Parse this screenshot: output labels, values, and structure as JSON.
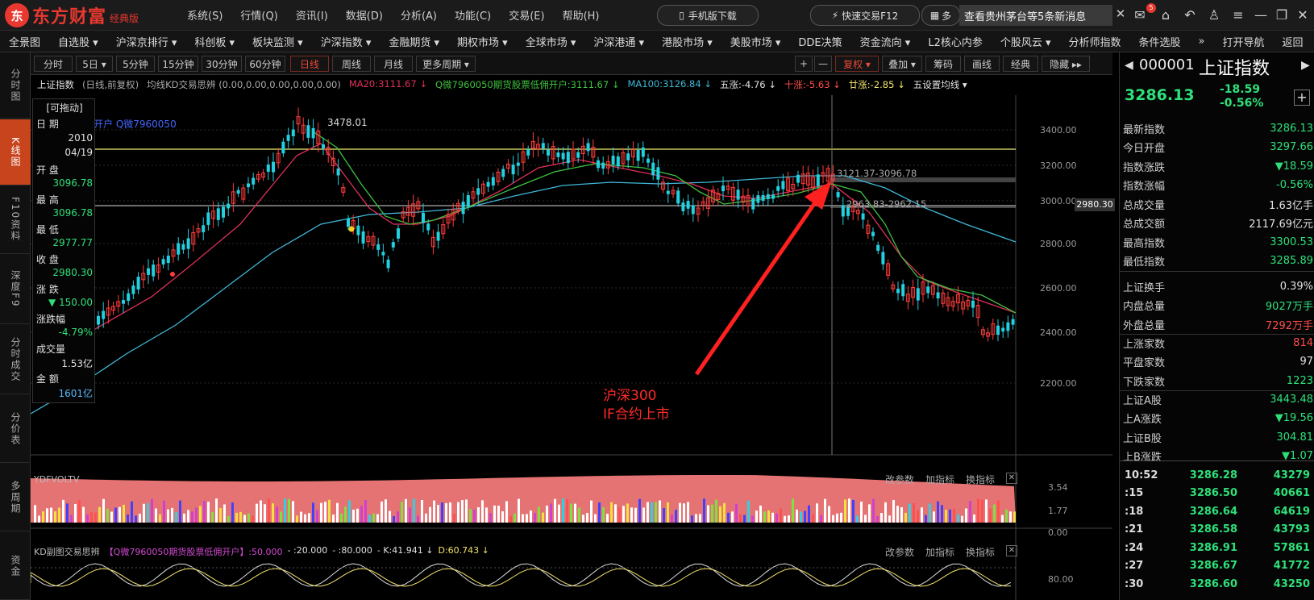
{
  "titlebar": {
    "logo_text": "东方财富",
    "edition": "经典版",
    "menu": [
      "系统(S)",
      "行情(Q)",
      "资讯(I)",
      "数据(D)",
      "分析(A)",
      "功能(C)",
      "交易(E)",
      "帮助(H)"
    ],
    "mobile_button": "手机版下载",
    "quick_trade": "快速交易F12",
    "multi_label": "多",
    "notice": "查看贵州茅台等5条新消息",
    "mail_badge": "5"
  },
  "navbar": [
    "全景图",
    "自选股 ▾",
    "沪深京排行 ▾",
    "科创板 ▾",
    "板块监测 ▾",
    "沪深指数 ▾",
    "金融期货 ▾",
    "期权市场 ▾",
    "全球市场 ▾",
    "沪深港通 ▾",
    "港股市场 ▾",
    "美股市场 ▾",
    "DDE决策",
    "资金流向 ▾",
    "L2核心内参",
    "个股风云 ▾",
    "分析师指数",
    "条件选股",
    "»",
    "打开导航",
    "返回"
  ],
  "left_tabs": [
    {
      "label": "分时图",
      "active": false
    },
    {
      "label": "K线图",
      "active": true
    },
    {
      "label": "F10资料",
      "active": false
    },
    {
      "label": "深度F9",
      "active": false
    },
    {
      "label": "分时成交",
      "active": false
    },
    {
      "label": "分价表",
      "active": false
    },
    {
      "label": "多周期",
      "active": false
    },
    {
      "label": "资金",
      "active": false
    }
  ],
  "period_bar": {
    "items": [
      "分时",
      "5日 ▾",
      "5分钟",
      "15分钟",
      "30分钟",
      "60分钟",
      "日线",
      "周线",
      "月线",
      "更多周期 ▾"
    ],
    "active": "日线",
    "right_items": [
      "+",
      "—",
      "复权 ▾",
      "叠加 ▾",
      "筹码",
      "画线",
      "经典",
      "隐藏 ▸▸"
    ]
  },
  "chart_title": {
    "name": "上证指数",
    "mode": "(日线,前复权)",
    "indicator": "均线KD交易思辨 (0.00,0.00,0.00,0.00,0.00)",
    "ma20": "MA20:3111.67 ↓",
    "promo": "Q微7960050期货股票低佣开户:3111.67 ↓",
    "ma100": "MA100:3126.84 ↓",
    "wuzhang": "五涨:-4.76 ↓",
    "shizhang": "十涨:-5.63 ↓",
    "nianzhang": "廿涨:-2.85 ↓",
    "setting": "五设置均线 ▾"
  },
  "overlay_text": "开户 Q微7960050",
  "infobox": {
    "header": "[可拖动]",
    "date_label": "日 期",
    "date_year": "2010",
    "date_md": "04/19",
    "open_label": "开 盘",
    "open": "3096.78",
    "high_label": "最 高",
    "high": "3096.78",
    "low_label": "最 低",
    "low": "2977.77",
    "close_label": "收 盘",
    "close": "2980.30",
    "chg_label": "涨 跌",
    "chg": "▼ 150.00",
    "pct_label": "涨跌幅",
    "pct": "-4.79%",
    "vol_label": "成交量",
    "vol": "1.53亿",
    "amt_label": "金 额",
    "amt": "1601亿"
  },
  "annotations": {
    "peak": "3478.01",
    "range_top": "3121.37-3096.78",
    "range_bottom": "2963.83-2962.15",
    "event_line1": "沪深300",
    "event_line2": "IF合约上市"
  },
  "price_axis": {
    "ticks": [
      "3400.00",
      "3200.00",
      "3000.00",
      "2800.00",
      "2600.00",
      "2400.00",
      "2200.00"
    ],
    "current": "2980.30"
  },
  "volume_panel": {
    "title": "YDFVOLTV",
    "buttons": [
      "改参数",
      "加指标",
      "换指标"
    ],
    "ticks": [
      "3.54",
      "1.77",
      "0.00"
    ]
  },
  "kd_panel": {
    "title": "KD副图交易思辨",
    "promo": "【Q微7960050期货股票低佣开户】:50.000",
    "p1": "- :20.000",
    "p2": "- :80.000",
    "k": "- K:41.941 ↓",
    "d": "D:60.743 ↓",
    "buttons": [
      "改参数",
      "加指标",
      "换指标"
    ],
    "tick": "80.00"
  },
  "right_panel": {
    "code": "000001",
    "name": "上证指数",
    "price": "3286.13",
    "change": "-18.59",
    "change_pct": "-0.56%",
    "rows": [
      {
        "label": "最新指数",
        "value": "3286.13",
        "color": "g"
      },
      {
        "label": "今日开盘",
        "value": "3297.66",
        "color": "g"
      },
      {
        "label": "指数涨跌",
        "value": "▼18.59",
        "color": "g"
      },
      {
        "label": "指数涨幅",
        "value": "-0.56%",
        "color": "g"
      },
      {
        "label": "总成交量",
        "value": "1.63亿手",
        "color": "w"
      },
      {
        "label": "总成交额",
        "value": "2117.69亿元",
        "color": "w"
      },
      {
        "label": "最高指数",
        "value": "3300.53",
        "color": "g"
      },
      {
        "label": "最低指数",
        "value": "3285.89",
        "color": "g"
      },
      {
        "label": "上证换手",
        "value": "0.39%",
        "color": "w"
      },
      {
        "label": "内盘总量",
        "value": "9027万手",
        "color": "g"
      },
      {
        "label": "外盘总量",
        "value": "7292万手",
        "color": "r"
      },
      {
        "label": "上涨家数",
        "value": "814",
        "color": "r"
      },
      {
        "label": "平盘家数",
        "value": "97",
        "color": "w"
      },
      {
        "label": "下跌家数",
        "value": "1223",
        "color": "g"
      },
      {
        "label": "上证A股",
        "value": "3443.48",
        "color": "g"
      },
      {
        "label": "上A涨跌",
        "value": "▼19.56",
        "color": "g"
      },
      {
        "label": "上证B股",
        "value": "304.81",
        "color": "g"
      },
      {
        "label": "上B涨跌",
        "value": "▼1.07",
        "color": "g"
      }
    ],
    "ticks": [
      {
        "time": "10:52",
        "price": "3286.28",
        "vol": "43279"
      },
      {
        "time": ":15",
        "price": "3286.50",
        "vol": "40661"
      },
      {
        "time": ":18",
        "price": "3286.64",
        "vol": "64619"
      },
      {
        "time": ":21",
        "price": "3286.58",
        "vol": "43793"
      },
      {
        "time": ":24",
        "price": "3286.91",
        "vol": "57861"
      },
      {
        "time": ":27",
        "price": "3286.67",
        "vol": "41772"
      },
      {
        "time": ":30",
        "price": "3286.60",
        "vol": "43250"
      }
    ]
  },
  "colors": {
    "up": "#ff3c3c",
    "down": "#22d0e0",
    "ma5": "#dddd44",
    "ma20": "#e0305a",
    "ma60": "#3ec13e",
    "ma100": "#3fb8d8",
    "vol_band": "#ff8080"
  }
}
